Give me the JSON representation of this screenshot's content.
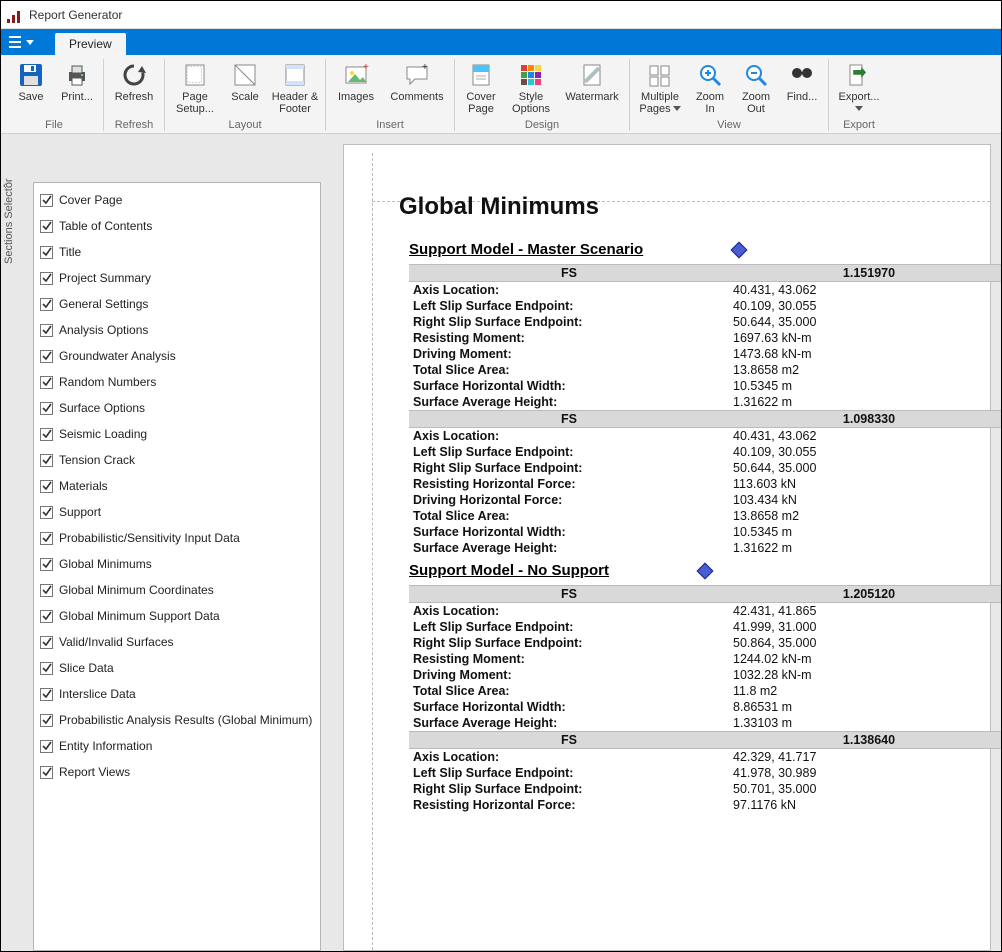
{
  "window": {
    "title": "Report Generator"
  },
  "tabs": {
    "preview": "Preview"
  },
  "ribbon": {
    "file": {
      "label": "File",
      "save": "Save",
      "print": "Print..."
    },
    "refresh": {
      "label": "Refresh",
      "btn": "Refresh"
    },
    "layout": {
      "label": "Layout",
      "page_setup": "Page\nSetup...",
      "scale": "Scale",
      "header_footer": "Header &\nFooter"
    },
    "insert": {
      "label": "Insert",
      "images": "Images",
      "comments": "Comments"
    },
    "design": {
      "label": "Design",
      "cover": "Cover\nPage",
      "style": "Style\nOptions",
      "watermark": "Watermark"
    },
    "view": {
      "label": "View",
      "multi": "Multiple\nPages",
      "zoomin": "Zoom\nIn",
      "zoomout": "Zoom\nOut",
      "find": "Find..."
    },
    "export": {
      "label": "Export",
      "btn": "Export..."
    }
  },
  "sidebar": {
    "title": "Sections Selector",
    "items": [
      "Cover Page",
      "Table of Contents",
      "Title",
      "Project Summary",
      "General Settings",
      "Analysis Options",
      "Groundwater Analysis",
      "Random Numbers",
      "Surface Options",
      "Seismic Loading",
      "Tension Crack",
      "Materials",
      "Support",
      "Probabilistic/Sensitivity Input Data",
      "Global Minimums",
      "Global Minimum Coordinates",
      "Global Minimum Support Data",
      "Valid/Invalid Surfaces",
      "Slice Data",
      "Interslice Data",
      "Probabilistic Analysis Results (Global Minimum)",
      "Entity Information",
      "Report Views"
    ]
  },
  "doc": {
    "title": "Global Minimums",
    "fs_label": "FS",
    "models": [
      {
        "name": "Support Model - Master Scenario",
        "blocks": [
          {
            "fs": "1.151970",
            "rows": [
              [
                "Axis Location:",
                "40.431, 43.062"
              ],
              [
                "Left Slip Surface Endpoint:",
                "40.109, 30.055"
              ],
              [
                "Right Slip Surface Endpoint:",
                "50.644, 35.000"
              ],
              [
                "Resisting Moment:",
                "1697.63 kN-m"
              ],
              [
                "Driving Moment:",
                "1473.68 kN-m"
              ],
              [
                "Total Slice Area:",
                "13.8658 m2"
              ],
              [
                "Surface Horizontal Width:",
                "10.5345 m"
              ],
              [
                "Surface Average Height:",
                "1.31622 m"
              ]
            ]
          },
          {
            "fs": "1.098330",
            "rows": [
              [
                "Axis Location:",
                "40.431, 43.062"
              ],
              [
                "Left Slip Surface Endpoint:",
                "40.109, 30.055"
              ],
              [
                "Right Slip Surface Endpoint:",
                "50.644, 35.000"
              ],
              [
                "Resisting Horizontal Force:",
                "113.603 kN"
              ],
              [
                "Driving Horizontal Force:",
                "103.434 kN"
              ],
              [
                "Total Slice Area:",
                "13.8658 m2"
              ],
              [
                "Surface Horizontal Width:",
                "10.5345 m"
              ],
              [
                "Surface Average Height:",
                "1.31622 m"
              ]
            ]
          }
        ]
      },
      {
        "name": "Support Model - No Support",
        "blocks": [
          {
            "fs": "1.205120",
            "rows": [
              [
                "Axis Location:",
                "42.431, 41.865"
              ],
              [
                "Left Slip Surface Endpoint:",
                "41.999, 31.000"
              ],
              [
                "Right Slip Surface Endpoint:",
                "50.864, 35.000"
              ],
              [
                "Resisting Moment:",
                "1244.02 kN-m"
              ],
              [
                "Driving Moment:",
                "1032.28 kN-m"
              ],
              [
                "Total Slice Area:",
                "11.8 m2"
              ],
              [
                "Surface Horizontal Width:",
                "8.86531 m"
              ],
              [
                "Surface Average Height:",
                "1.33103 m"
              ]
            ]
          },
          {
            "fs": "1.138640",
            "rows": [
              [
                "Axis Location:",
                "42.329, 41.717"
              ],
              [
                "Left Slip Surface Endpoint:",
                "41.978, 30.989"
              ],
              [
                "Right Slip Surface Endpoint:",
                "50.701, 35.000"
              ],
              [
                "Resisting Horizontal Force:",
                "97.1176 kN"
              ]
            ]
          }
        ]
      }
    ]
  }
}
